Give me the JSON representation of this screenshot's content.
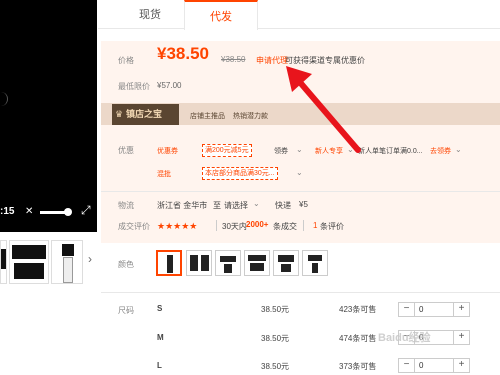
{
  "video": {
    "time": ":15"
  },
  "tabs": [
    {
      "label": "现货"
    },
    {
      "label": "代发"
    }
  ],
  "price": {
    "label": "价格",
    "current": "¥38.50",
    "original": "¥38.50",
    "agent_link": "申请代理",
    "agent_desc": "可获得渠道专属优惠价",
    "lowest_label": "最低限价",
    "lowest_value": "¥57.00"
  },
  "shop": {
    "badge": "镇店之宝",
    "item1": "店铺主推品",
    "item2": "热销潜力款"
  },
  "promo": {
    "label": "优惠",
    "coupon_tag": "优惠券",
    "coupon_value": "满200元减5元",
    "coupon_action": "领券",
    "newcomer": "新人专享",
    "newcomer_desc": "新人单笔订单满0.0...",
    "newcomer_action": "去领券",
    "mix_tag": "混批",
    "mix_value": "本店部分商品满30元..."
  },
  "shipping": {
    "label": "物流",
    "from": "浙江省 金华市",
    "to_word": "至",
    "select": "请选择",
    "method": "快递",
    "fee": "¥5"
  },
  "reviews": {
    "label": "成交评价",
    "stars": "★★★★★",
    "days": "30天内",
    "count": "2000+",
    "count_suffix": "条成交",
    "review_num": "1",
    "review_suffix": "条评价"
  },
  "color": {
    "label": "颜色"
  },
  "sizes": {
    "label": "尺码",
    "rows": [
      {
        "size": "S",
        "price": "38.50元",
        "stock": "423条可售",
        "qty": "0"
      },
      {
        "size": "M",
        "price": "38.50元",
        "stock": "474条可售",
        "qty": "0"
      },
      {
        "size": "L",
        "price": "38.50元",
        "stock": "373条可售",
        "qty": "0"
      }
    ]
  },
  "watermark": "Baidu经验"
}
